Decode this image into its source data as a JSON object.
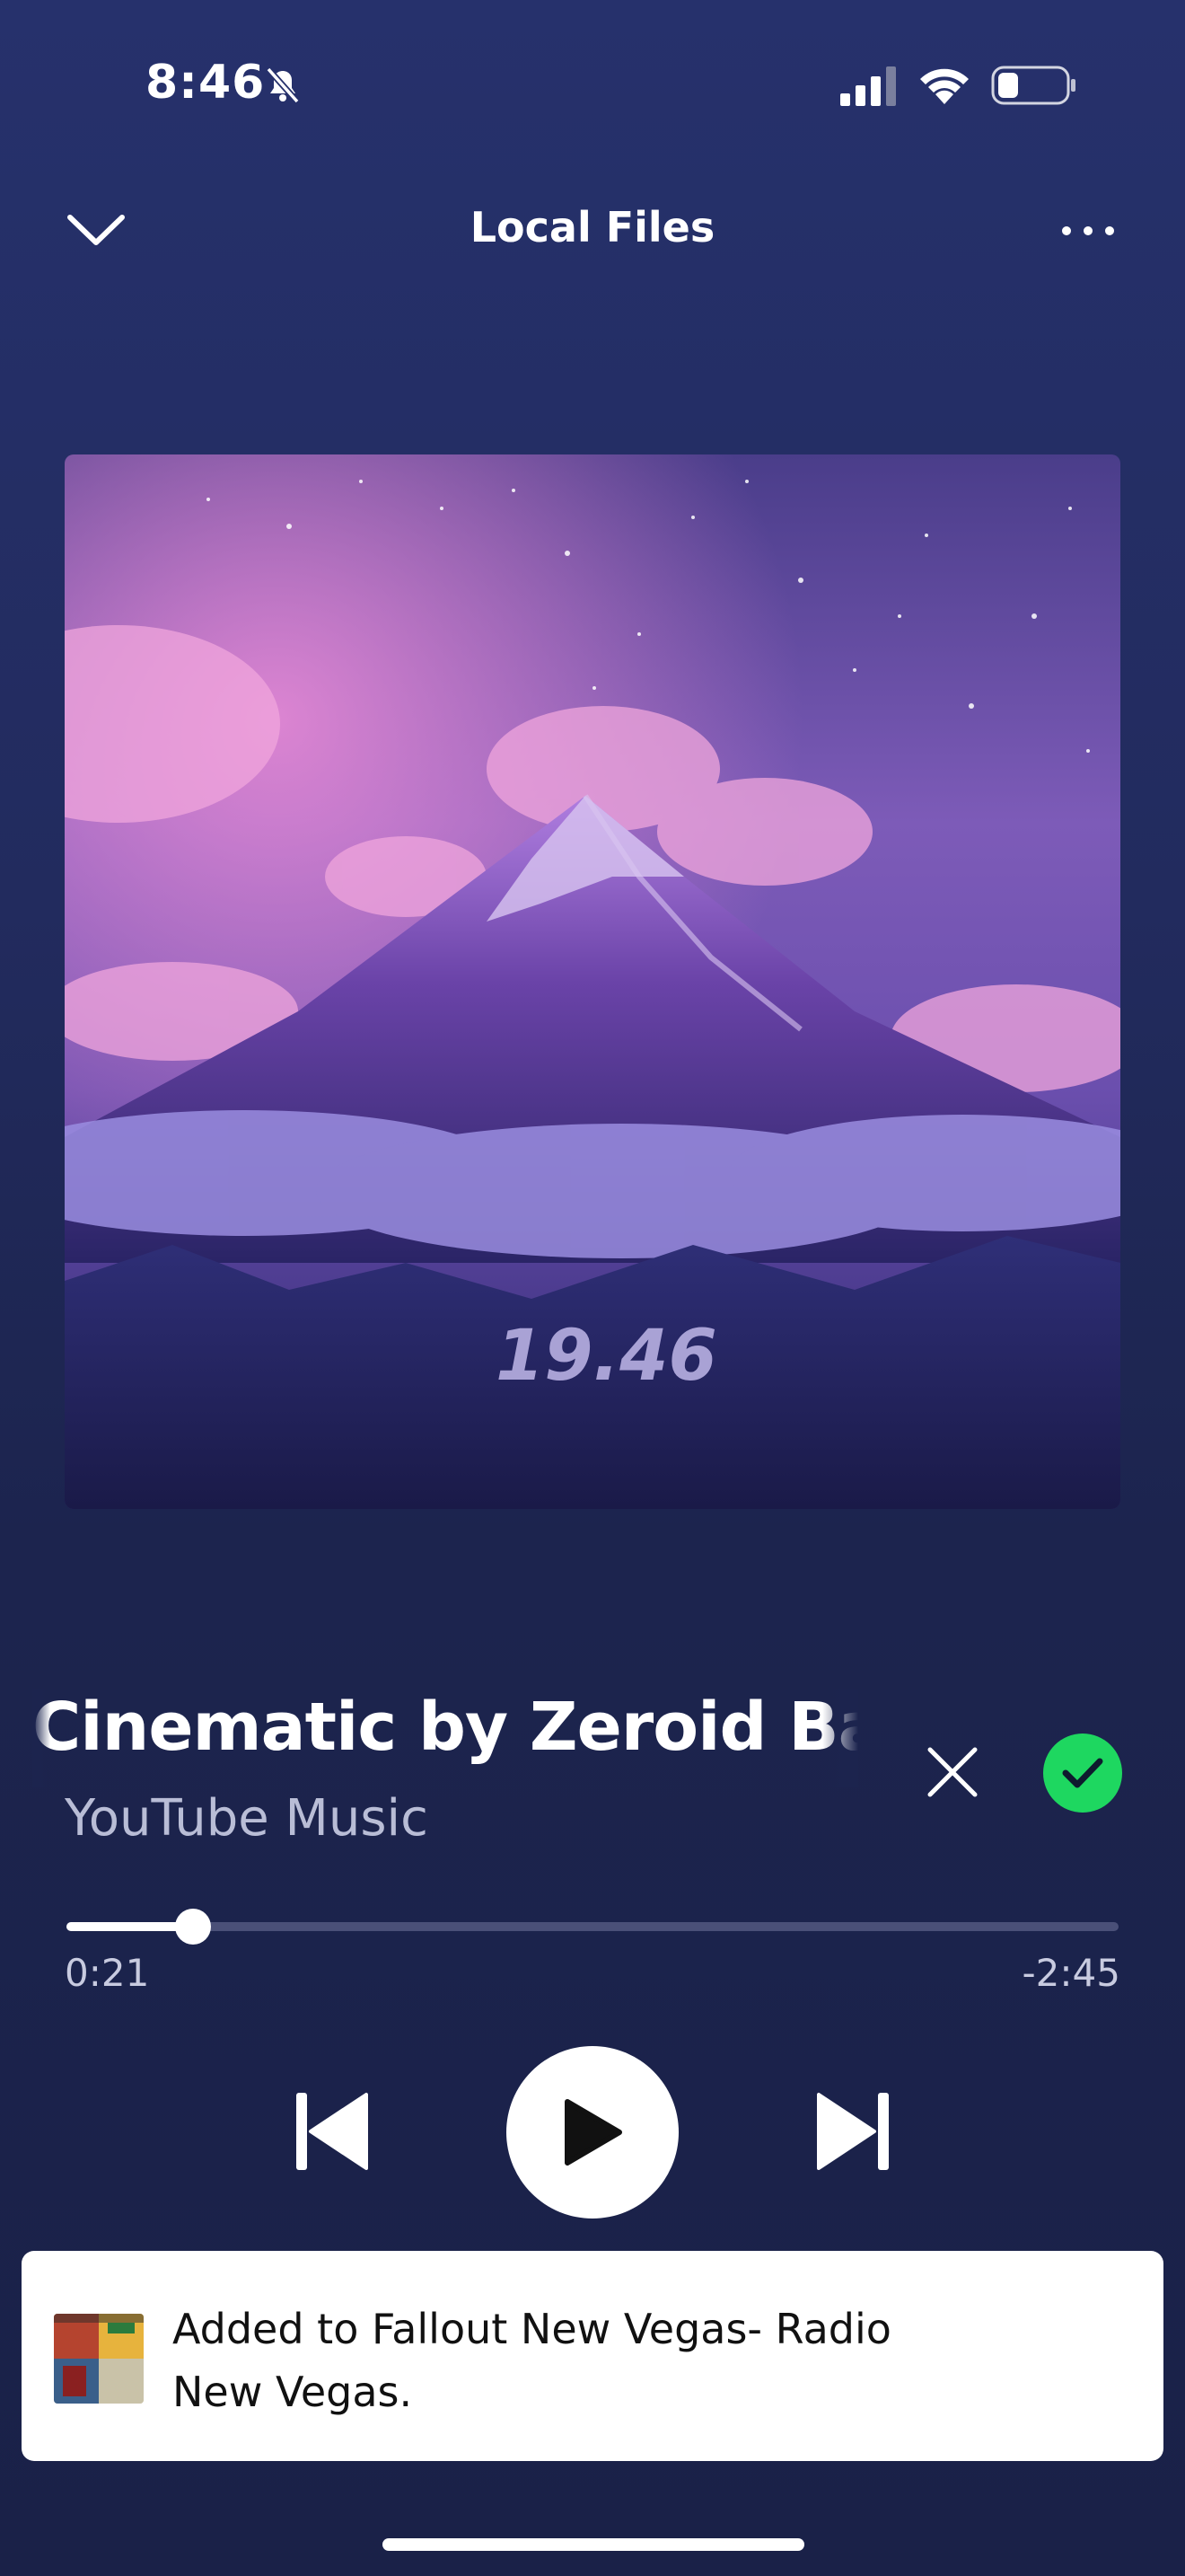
{
  "status_bar": {
    "time": "8:46",
    "icons": [
      "bell-slash-icon",
      "cellular-signal-icon",
      "wifi-icon",
      "battery-icon"
    ]
  },
  "header": {
    "title": "Local Files",
    "left_icon": "chevron-down-icon",
    "right_icon": "more-icon"
  },
  "album_art": {
    "text": "19.46"
  },
  "track": {
    "title": "Cinematic by Zeroid   Batt",
    "artist": "YouTube Music",
    "elapsed": "0:21",
    "remaining": "-2:45",
    "progress_fraction": 0.12
  },
  "controls": {
    "icons": [
      "skip-previous-icon",
      "play-icon",
      "skip-next-icon"
    ]
  },
  "toast": {
    "message": "Added to Fallout New Vegas- Radio New Vegas."
  },
  "colors": {
    "accent_green": "#1ed760",
    "background": "#222b5e",
    "toast_background": "#ffffff"
  }
}
